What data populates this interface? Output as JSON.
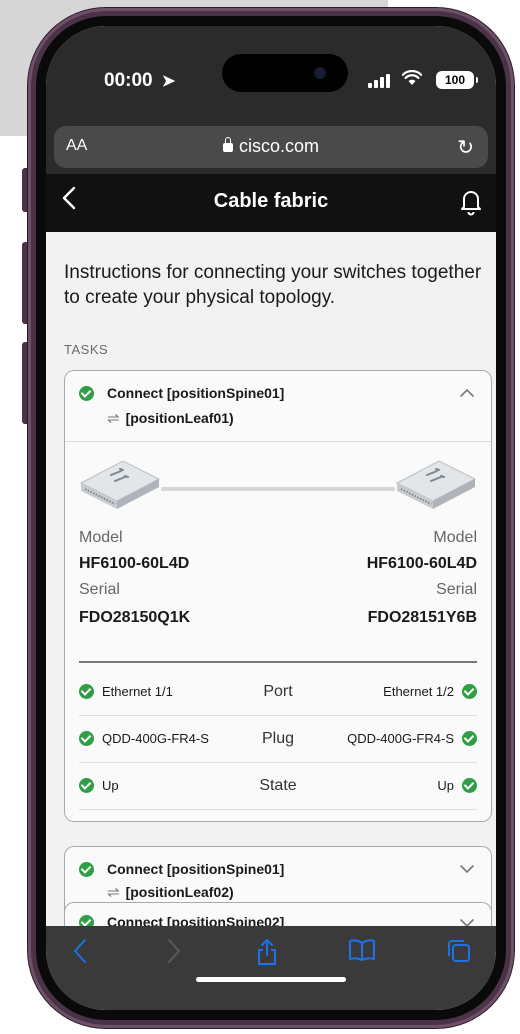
{
  "status_bar": {
    "time": "00:00",
    "battery": "100"
  },
  "browser": {
    "text_size": "AA",
    "domain": "cisco.com"
  },
  "app_bar": {
    "title": "Cable fabric"
  },
  "intro": "Instructions for connecting your switches together to create your physical topology.",
  "tasks_label": "TASKS",
  "tasks": [
    {
      "title": "Connect [positionSpine01]",
      "target": "[positionLeaf01)",
      "expanded": true,
      "left": {
        "model_label": "Model",
        "model": "HF6100-60L4D",
        "serial_label": "Serial",
        "serial": "FDO28150Q1K"
      },
      "right": {
        "model_label": "Model",
        "model": "HF6100-60L4D",
        "serial_label": "Serial",
        "serial": "FDO28151Y6B"
      },
      "rows": [
        {
          "left": "Ethernet 1/1",
          "label": "Port",
          "right": "Ethernet 1/2"
        },
        {
          "left": "QDD-400G-FR4-S",
          "label": "Plug",
          "right": "QDD-400G-FR4-S"
        },
        {
          "left": "Up",
          "label": "State",
          "right": "Up"
        }
      ]
    },
    {
      "title": "Connect [positionSpine01]",
      "target": "[positionLeaf02)",
      "expanded": false
    },
    {
      "title": "Connect [positionSpine02]",
      "expanded": false
    }
  ],
  "colors": {
    "success": "#2f9e44",
    "header": "#111111",
    "frame": "#4a3346",
    "toolbar_icon": "#1a73e8"
  },
  "icons": {
    "location": "location-arrow-icon",
    "signal": "cellular-signal-icon",
    "wifi": "wifi-icon",
    "lock": "lock-icon",
    "reload": "reload-icon",
    "back": "chevron-left-icon",
    "bell": "bell-icon",
    "toolbar": [
      "back-arrow-icon",
      "forward-arrow-icon",
      "share-icon",
      "bookmarks-icon",
      "tabs-icon"
    ]
  }
}
